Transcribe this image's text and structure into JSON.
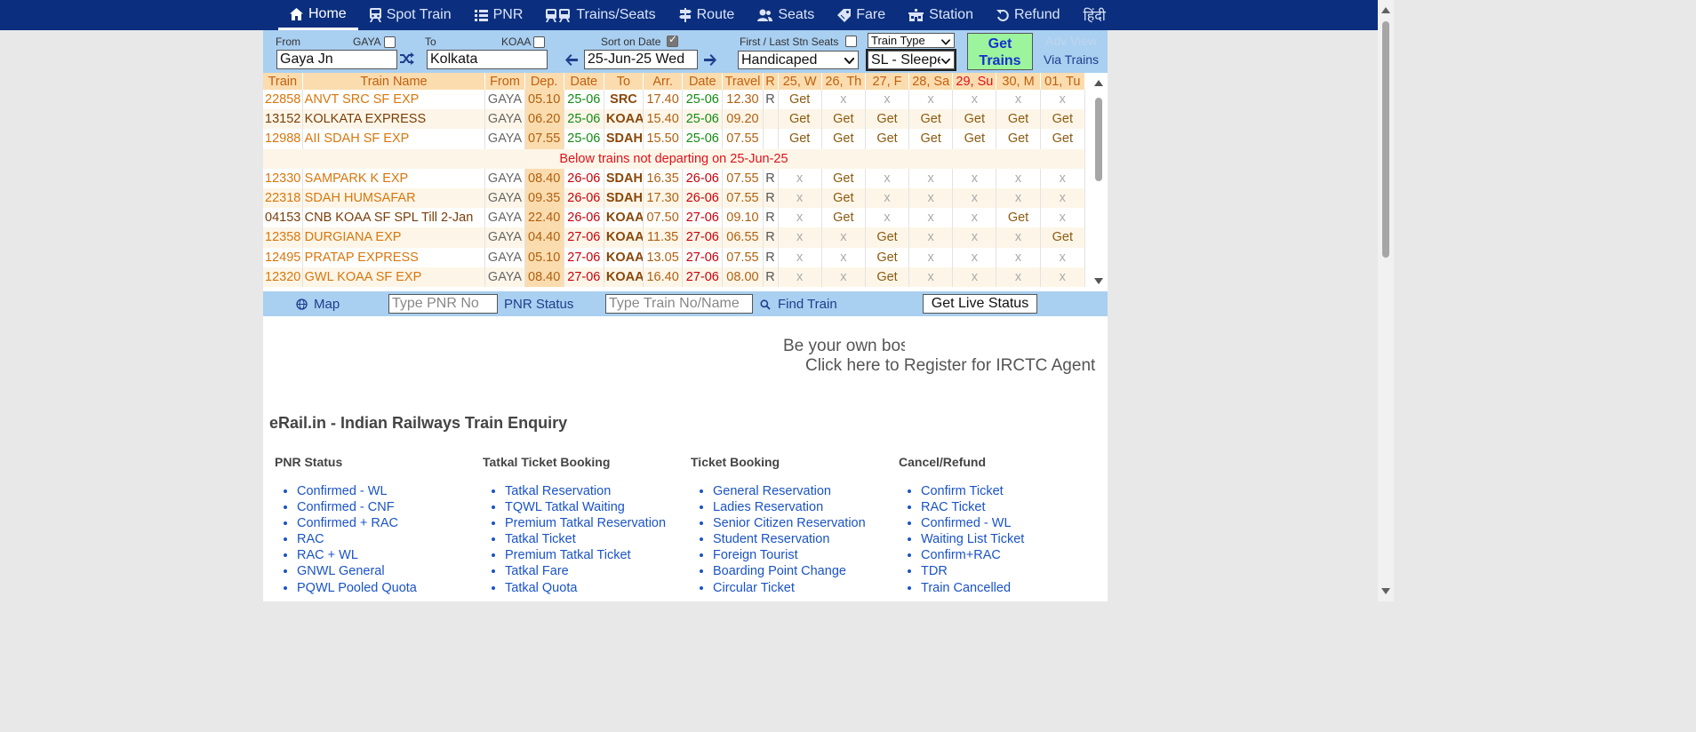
{
  "nav": {
    "items": [
      {
        "label": "Home",
        "icon": "home-icon",
        "active": true
      },
      {
        "label": "Spot Train",
        "icon": "train-icon"
      },
      {
        "label": "PNR",
        "icon": "list-icon"
      },
      {
        "label": "Trains/Seats",
        "icon": "trains-icon"
      },
      {
        "label": "Route",
        "icon": "signpost-icon"
      },
      {
        "label": "Seats",
        "icon": "users-icon"
      },
      {
        "label": "Fare",
        "icon": "tag-icon"
      },
      {
        "label": "Station",
        "icon": "station-icon"
      },
      {
        "label": "Refund",
        "icon": "undo-icon"
      },
      {
        "label": "हिंदी",
        "icon": ""
      }
    ]
  },
  "form": {
    "from_label": "From",
    "from_code": "GAYA",
    "from_value": "Gaya Jn",
    "to_label": "To",
    "to_code": "KOAA",
    "to_value": "Kolkata",
    "sort_label": "Sort on Date",
    "date_value": "25-Jun-25 Wed",
    "first_last_label": "First / Last Stn Seats",
    "train_type": "Train Type",
    "quota": "Handicaped",
    "class": "SL - Sleeper",
    "get_trains": [
      "Get",
      "Trains"
    ],
    "adv_view": "Adv View",
    "via_trains": "Via Trains"
  },
  "table": {
    "headers": [
      "Train",
      "Train Name",
      "From",
      "Dep.",
      "Date",
      "To",
      "Arr.",
      "Date",
      "Travel",
      "R",
      "25, W",
      "26, Th",
      "27, F",
      "28, Sa",
      "29, Su",
      "30, M",
      "01, Tu"
    ],
    "rows": [
      {
        "no": "22858",
        "name": "ANVT SRC SF EXP",
        "from": "GAYA",
        "dep": "05.10",
        "ddate": "25-06",
        "to": "SRC",
        "arr": "17.40",
        "adate": "25-06",
        "travel": "12.30",
        "r": "R",
        "days": [
          "Get",
          "x",
          "x",
          "x",
          "x",
          "x",
          "x"
        ]
      },
      {
        "no": "13152",
        "name": "KOLKATA EXPRESS",
        "from": "GAYA",
        "dep": "06.20",
        "ddate": "25-06",
        "to": "KOAA",
        "arr": "15.40",
        "adate": "25-06",
        "travel": "09.20",
        "r": "",
        "days": [
          "Get",
          "Get",
          "Get",
          "Get",
          "Get",
          "Get",
          "Get"
        ]
      },
      {
        "no": "12988",
        "name": "AII SDAH SF EXP",
        "from": "GAYA",
        "dep": "07.55",
        "ddate": "25-06",
        "to": "SDAH",
        "arr": "15.50",
        "adate": "25-06",
        "travel": "07.55",
        "r": "",
        "days": [
          "Get",
          "Get",
          "Get",
          "Get",
          "Get",
          "Get",
          "Get"
        ]
      },
      {
        "notice": "Below trains not departing on 25-Jun-25"
      },
      {
        "no": "12330",
        "name": "SAMPARK K EXP",
        "from": "GAYA",
        "dep": "08.40",
        "ddate": "26-06",
        "to": "SDAH",
        "arr": "16.35",
        "adate": "26-06",
        "travel": "07.55",
        "r": "R",
        "days": [
          "x",
          "Get",
          "x",
          "x",
          "x",
          "x",
          "x"
        ]
      },
      {
        "no": "22318",
        "name": "SDAH HUMSAFAR",
        "from": "GAYA",
        "dep": "09.35",
        "ddate": "26-06",
        "to": "SDAH",
        "arr": "17.30",
        "adate": "26-06",
        "travel": "07.55",
        "r": "R",
        "days": [
          "x",
          "Get",
          "x",
          "x",
          "x",
          "x",
          "x"
        ]
      },
      {
        "no": "04153",
        "name": "CNB KOAA SF SPL",
        "till": "Till 2-Jan",
        "from": "GAYA",
        "dep": "22.40",
        "ddate": "26-06",
        "to": "KOAA",
        "arr": "07.50",
        "adate": "27-06",
        "travel": "09.10",
        "r": "R",
        "days": [
          "x",
          "Get",
          "x",
          "x",
          "x",
          "Get",
          "x"
        ]
      },
      {
        "no": "12358",
        "name": "DURGIANA EXP",
        "from": "GAYA",
        "dep": "04.40",
        "ddate": "27-06",
        "to": "KOAA",
        "arr": "11.35",
        "adate": "27-06",
        "travel": "06.55",
        "r": "R",
        "days": [
          "x",
          "x",
          "Get",
          "x",
          "x",
          "x",
          "Get"
        ]
      },
      {
        "no": "12495",
        "name": "PRATAP EXPRESS",
        "from": "GAYA",
        "dep": "05.10",
        "ddate": "27-06",
        "to": "KOAA",
        "arr": "13.05",
        "adate": "27-06",
        "travel": "07.55",
        "r": "R",
        "days": [
          "x",
          "x",
          "Get",
          "x",
          "x",
          "x",
          "x"
        ]
      },
      {
        "no": "12320",
        "name": "GWL KOAA SF EXP",
        "from": "GAYA",
        "dep": "08.40",
        "ddate": "27-06",
        "to": "KOAA",
        "arr": "16.40",
        "adate": "27-06",
        "travel": "08.00",
        "r": "R",
        "days": [
          "x",
          "x",
          "Get",
          "x",
          "x",
          "x",
          "x"
        ]
      }
    ]
  },
  "toolbar": {
    "map_label": "Map",
    "pnr_placeholder": "Type PNR No",
    "pnr_status": "PNR Status",
    "train_placeholder": "Type Train No/Name",
    "find_train": "Find Train",
    "live_status": "Get Live Status"
  },
  "promo": {
    "line1": "Be your own boss",
    "line2": "Click here to Register for IRCTC Agent"
  },
  "site_heading": "eRail.in - Indian Railways Train Enquiry",
  "columns": [
    {
      "title": "PNR Status",
      "links": [
        "Confirmed - WL",
        "Confirmed - CNF",
        "Confirmed + RAC",
        "RAC",
        "RAC + WL",
        "GNWL General",
        "PQWL Pooled Quota"
      ]
    },
    {
      "title": "Tatkal Ticket Booking",
      "links": [
        "Tatkal Reservation",
        "TQWL Tatkal Waiting",
        "Premium Tatkal Reservation",
        "Tatkal Ticket",
        "Premium Tatkal Ticket",
        "Tatkal Fare",
        "Tatkal Quota"
      ]
    },
    {
      "title": "Ticket Booking",
      "links": [
        "General Reservation",
        "Ladies Reservation",
        "Senior Citizen Reservation",
        "Student Reservation",
        "Foreign Tourist",
        "Boarding Point Change",
        "Circular Ticket"
      ]
    },
    {
      "title": "Cancel/Refund",
      "links": [
        "Confirm Ticket",
        "RAC Ticket",
        "Confirmed - WL",
        "Waiting List Ticket",
        "Confirm+RAC",
        "TDR",
        "Train Cancelled"
      ]
    }
  ]
}
